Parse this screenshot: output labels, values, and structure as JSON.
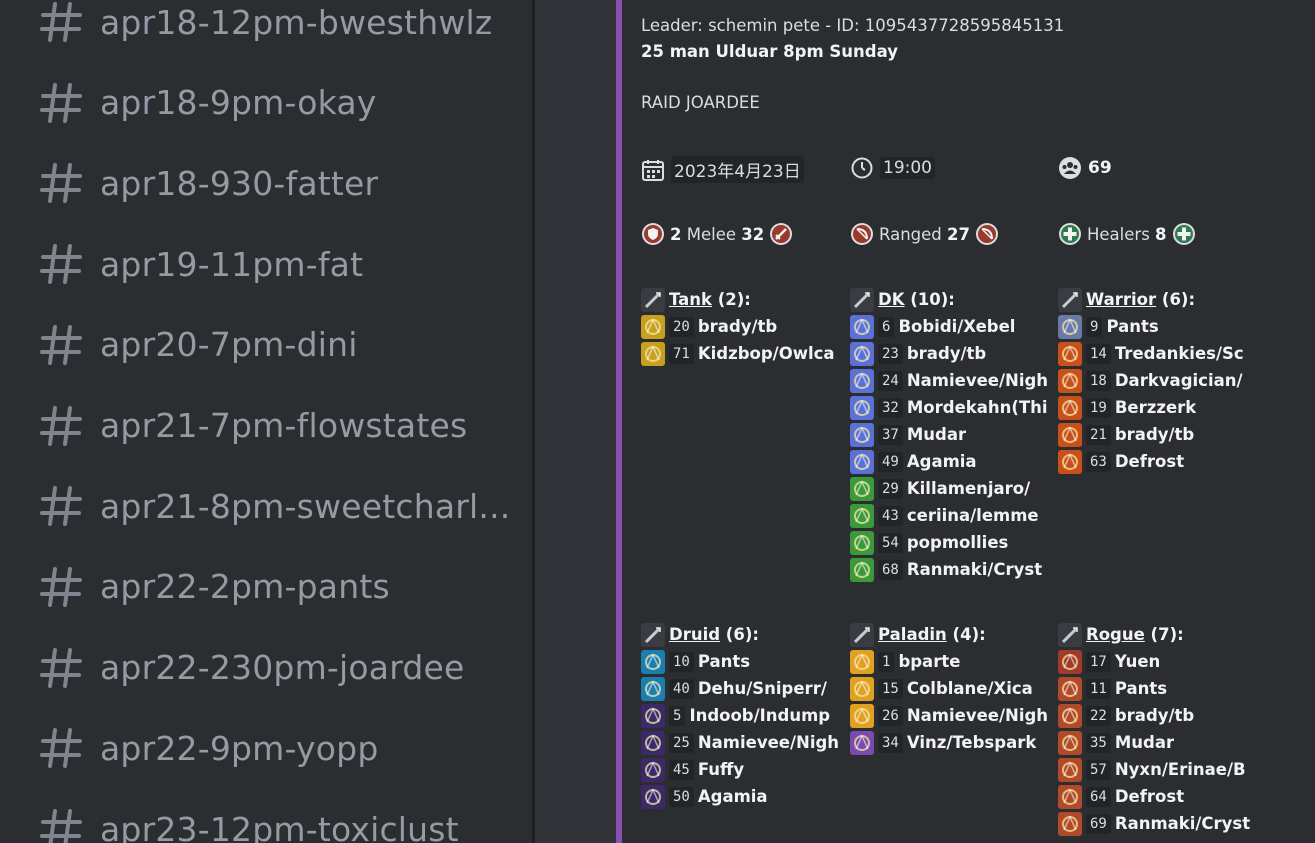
{
  "channels": [
    "apr18-12pm-bwesthwlz",
    "apr18-9pm-okay",
    "apr18-930-fatter",
    "apr19-11pm-fat",
    "apr20-7pm-dini",
    "apr21-7pm-flowstates",
    "apr21-8pm-sweetcharl...",
    "apr22-2pm-pants",
    "apr22-230pm-joardee",
    "apr22-9pm-yopp",
    "apr23-12pm-toxiclust"
  ],
  "embed": {
    "leader_line": "Leader: schemin pete - ID: 1095437728595845131",
    "title": "25 man Ulduar 8pm Sunday",
    "description": "RAID JOARDEE",
    "date": "2023年4月23日",
    "time": "19:00",
    "signups": "69",
    "roles": {
      "melee_prefix": "2",
      "melee_label": "Melee",
      "melee_count": "32",
      "ranged_label": "Ranged",
      "ranged_count": "27",
      "healers_label": "Healers",
      "healers_count": "8"
    },
    "accent_color": "#8a4fb0"
  },
  "classes": [
    {
      "name": "Tank",
      "count": "(2):",
      "class_icon": "tank-shield-icon",
      "players": [
        {
          "num": "20",
          "name": "brady/tb",
          "icon": "protection-paladin-icon",
          "color": "#c8a020"
        },
        {
          "num": "71",
          "name": "Kidzbop/Owlca",
          "icon": "protection-paladin-icon",
          "color": "#c8a020"
        }
      ]
    },
    {
      "name": "DK",
      "count": "(10):",
      "class_icon": "death-knight-icon",
      "players": [
        {
          "num": "6",
          "name": "Bobidi/Xebel",
          "icon": "frost-dk-icon",
          "color": "#5a72d8"
        },
        {
          "num": "23",
          "name": "brady/tb",
          "icon": "frost-dk-icon",
          "color": "#5a72d8"
        },
        {
          "num": "24",
          "name": "Namievee/Nigh",
          "icon": "frost-dk-icon",
          "color": "#5a72d8"
        },
        {
          "num": "32",
          "name": "Mordekahn(Thi",
          "icon": "frost-dk-icon",
          "color": "#5a72d8"
        },
        {
          "num": "37",
          "name": "Mudar",
          "icon": "frost-dk-icon",
          "color": "#5a72d8"
        },
        {
          "num": "49",
          "name": "Agamia",
          "icon": "frost-dk-icon",
          "color": "#5a72d8"
        },
        {
          "num": "29",
          "name": "Killamenjaro/",
          "icon": "unholy-dk-icon",
          "color": "#3a9a3a"
        },
        {
          "num": "43",
          "name": "ceriina/lemme",
          "icon": "unholy-dk-icon",
          "color": "#3a9a3a"
        },
        {
          "num": "54",
          "name": "popmollies",
          "icon": "unholy-dk-icon",
          "color": "#3a9a3a"
        },
        {
          "num": "68",
          "name": "Ranmaki/Cryst",
          "icon": "unholy-dk-icon",
          "color": "#3a9a3a"
        }
      ]
    },
    {
      "name": "Warrior",
      "count": "(6):",
      "class_icon": "warrior-sword-icon",
      "players": [
        {
          "num": "9",
          "name": "Pants",
          "icon": "arms-warrior-icon",
          "color": "#6a7aa8"
        },
        {
          "num": "14",
          "name": "Tredankies/Sc",
          "icon": "fury-warrior-icon",
          "color": "#c8501a"
        },
        {
          "num": "18",
          "name": "Darkvagician/",
          "icon": "fury-warrior-icon",
          "color": "#c8501a"
        },
        {
          "num": "19",
          "name": "Berzzerk",
          "icon": "fury-warrior-icon",
          "color": "#c8501a"
        },
        {
          "num": "21",
          "name": "brady/tb",
          "icon": "fury-warrior-icon",
          "color": "#c8501a"
        },
        {
          "num": "63",
          "name": "Defrost",
          "icon": "fury-warrior-icon",
          "color": "#c8501a"
        }
      ]
    },
    {
      "name": "Druid",
      "count": "(6):",
      "class_icon": "druid-icon",
      "players": [
        {
          "num": "10",
          "name": "Pants",
          "icon": "feral-druid-icon",
          "color": "#1a7fb0"
        },
        {
          "num": "40",
          "name": "Dehu/Sniperr/",
          "icon": "feral-druid-icon",
          "color": "#1a7fb0"
        },
        {
          "num": "5",
          "name": "Indoob/Indump",
          "icon": "balance-druid-icon",
          "color": "#3a2a6a"
        },
        {
          "num": "25",
          "name": "Namievee/Nigh",
          "icon": "balance-druid-icon",
          "color": "#3a2a6a"
        },
        {
          "num": "45",
          "name": "Fuffy",
          "icon": "balance-druid-icon",
          "color": "#3a2a6a"
        },
        {
          "num": "50",
          "name": "Agamia",
          "icon": "balance-druid-icon",
          "color": "#3a2a6a"
        }
      ]
    },
    {
      "name": "Paladin",
      "count": "(4):",
      "class_icon": "paladin-icon",
      "players": [
        {
          "num": "1",
          "name": "bparte",
          "icon": "retribution-paladin-icon",
          "color": "#e0a020"
        },
        {
          "num": "15",
          "name": "Colblane/Xica",
          "icon": "retribution-paladin-icon",
          "color": "#e0a020"
        },
        {
          "num": "26",
          "name": "Namievee/Nigh",
          "icon": "retribution-paladin-icon",
          "color": "#e0a020"
        },
        {
          "num": "34",
          "name": "Vinz/Tebspark",
          "icon": "holy-paladin-icon",
          "color": "#7a4ab0"
        }
      ]
    },
    {
      "name": "Rogue",
      "count": "(7):",
      "class_icon": "rogue-dagger-icon",
      "players": [
        {
          "num": "17",
          "name": "Yuen",
          "icon": "assassination-rogue-icon",
          "color": "#a03a2a"
        },
        {
          "num": "11",
          "name": "Pants",
          "icon": "combat-rogue-icon",
          "color": "#b04a2a"
        },
        {
          "num": "22",
          "name": "brady/tb",
          "icon": "combat-rogue-icon",
          "color": "#b04a2a"
        },
        {
          "num": "35",
          "name": "Mudar",
          "icon": "combat-rogue-icon",
          "color": "#b04a2a"
        },
        {
          "num": "57",
          "name": "Nyxn/Erinae/B",
          "icon": "combat-rogue-icon",
          "color": "#b04a2a"
        },
        {
          "num": "64",
          "name": "Defrost",
          "icon": "combat-rogue-icon",
          "color": "#b04a2a"
        },
        {
          "num": "69",
          "name": "Ranmaki/Cryst",
          "icon": "combat-rogue-icon",
          "color": "#b04a2a"
        }
      ]
    }
  ]
}
